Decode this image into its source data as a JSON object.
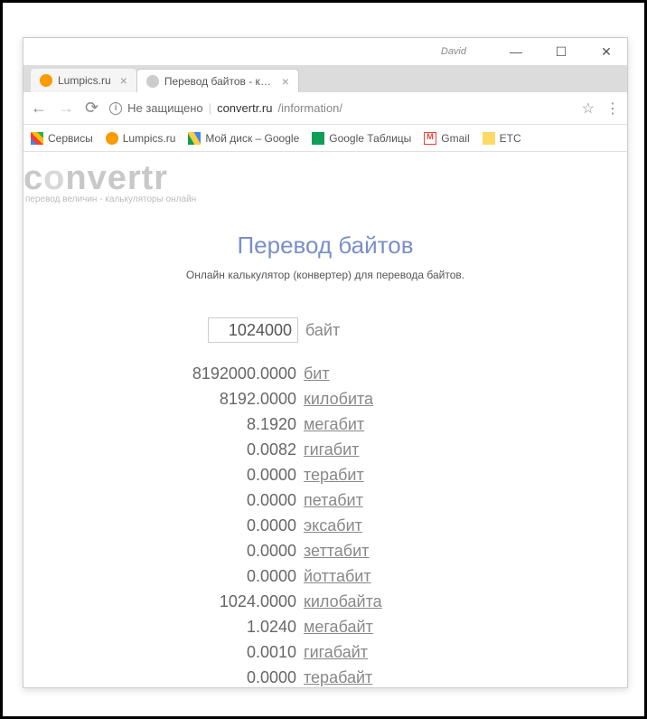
{
  "titlebar": {
    "user": "David"
  },
  "tabs": [
    {
      "title": "Lumpics.ru",
      "active": false
    },
    {
      "title": "Перевод байтов - конве",
      "active": true
    }
  ],
  "address": {
    "secure_label": "Не защищено",
    "domain": "convertr.ru",
    "path": "/information/"
  },
  "bookmarks": {
    "services": "Сервисы",
    "lumpics": "Lumpics.ru",
    "drive": "Мой диск – Google",
    "sheets": "Google Таблицы",
    "gmail": "Gmail",
    "etc": "ETC"
  },
  "logo": {
    "text_before": "c",
    "text_o": "o",
    "text_after": "nvertr",
    "subtitle": "перевод величин - калькуляторы онлайн"
  },
  "page": {
    "title": "Перевод байтов",
    "subtitle": "Онлайн калькулятор (конвертер) для перевода байтов."
  },
  "input": {
    "value": "1024000",
    "unit": "байт"
  },
  "results": [
    {
      "value": "8192000.0000",
      "unit": "бит"
    },
    {
      "value": "8192.0000",
      "unit": "килобита"
    },
    {
      "value": "8.1920",
      "unit": "мегабит"
    },
    {
      "value": "0.0082",
      "unit": "гигабит"
    },
    {
      "value": "0.0000",
      "unit": "терабит"
    },
    {
      "value": "0.0000",
      "unit": "петабит"
    },
    {
      "value": "0.0000",
      "unit": "эксабит"
    },
    {
      "value": "0.0000",
      "unit": "зеттабит"
    },
    {
      "value": "0.0000",
      "unit": "йоттабит"
    },
    {
      "value": "1024.0000",
      "unit": "килобайта"
    },
    {
      "value": "1.0240",
      "unit": "мегабайт"
    },
    {
      "value": "0.0010",
      "unit": "гигабайт"
    },
    {
      "value": "0.0000",
      "unit": "терабайт"
    }
  ]
}
